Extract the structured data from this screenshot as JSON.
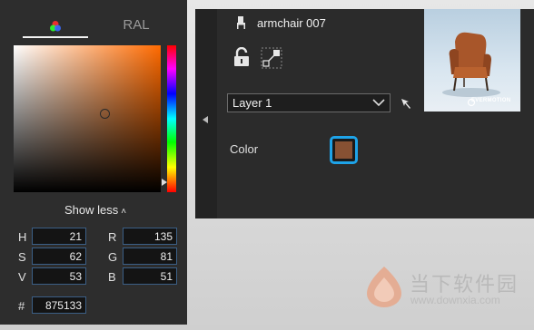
{
  "picker": {
    "tab_color_icon": "rgb-circles-icon",
    "tab_ral": "RAL",
    "show_less": "Show less",
    "fields": {
      "h_label": "H",
      "h_value": "21",
      "s_label": "S",
      "s_value": "62",
      "v_label": "V",
      "v_value": "53",
      "r_label": "R",
      "r_value": "135",
      "g_label": "G",
      "g_value": "81",
      "b_label": "B",
      "b_value": "51",
      "hex_label": "#",
      "hex_value": "875133"
    },
    "sv_field_hue_color": "#ff6a00"
  },
  "material": {
    "object_icon": "chair-icon",
    "object_name": "armchair 007",
    "lock_icon": "unlock-icon",
    "scale_icon": "scale-icon",
    "layer_value": "Layer 1",
    "pick_tool_icon": "eyedropper-arrow-icon",
    "color_label": "Color",
    "color_value": "#875133",
    "swatch_border_color": "#1ea3e8",
    "thumbnail_brand": "EVERMOTION"
  },
  "watermark": {
    "title": "当下软件园",
    "url": "www.downxia.com"
  }
}
